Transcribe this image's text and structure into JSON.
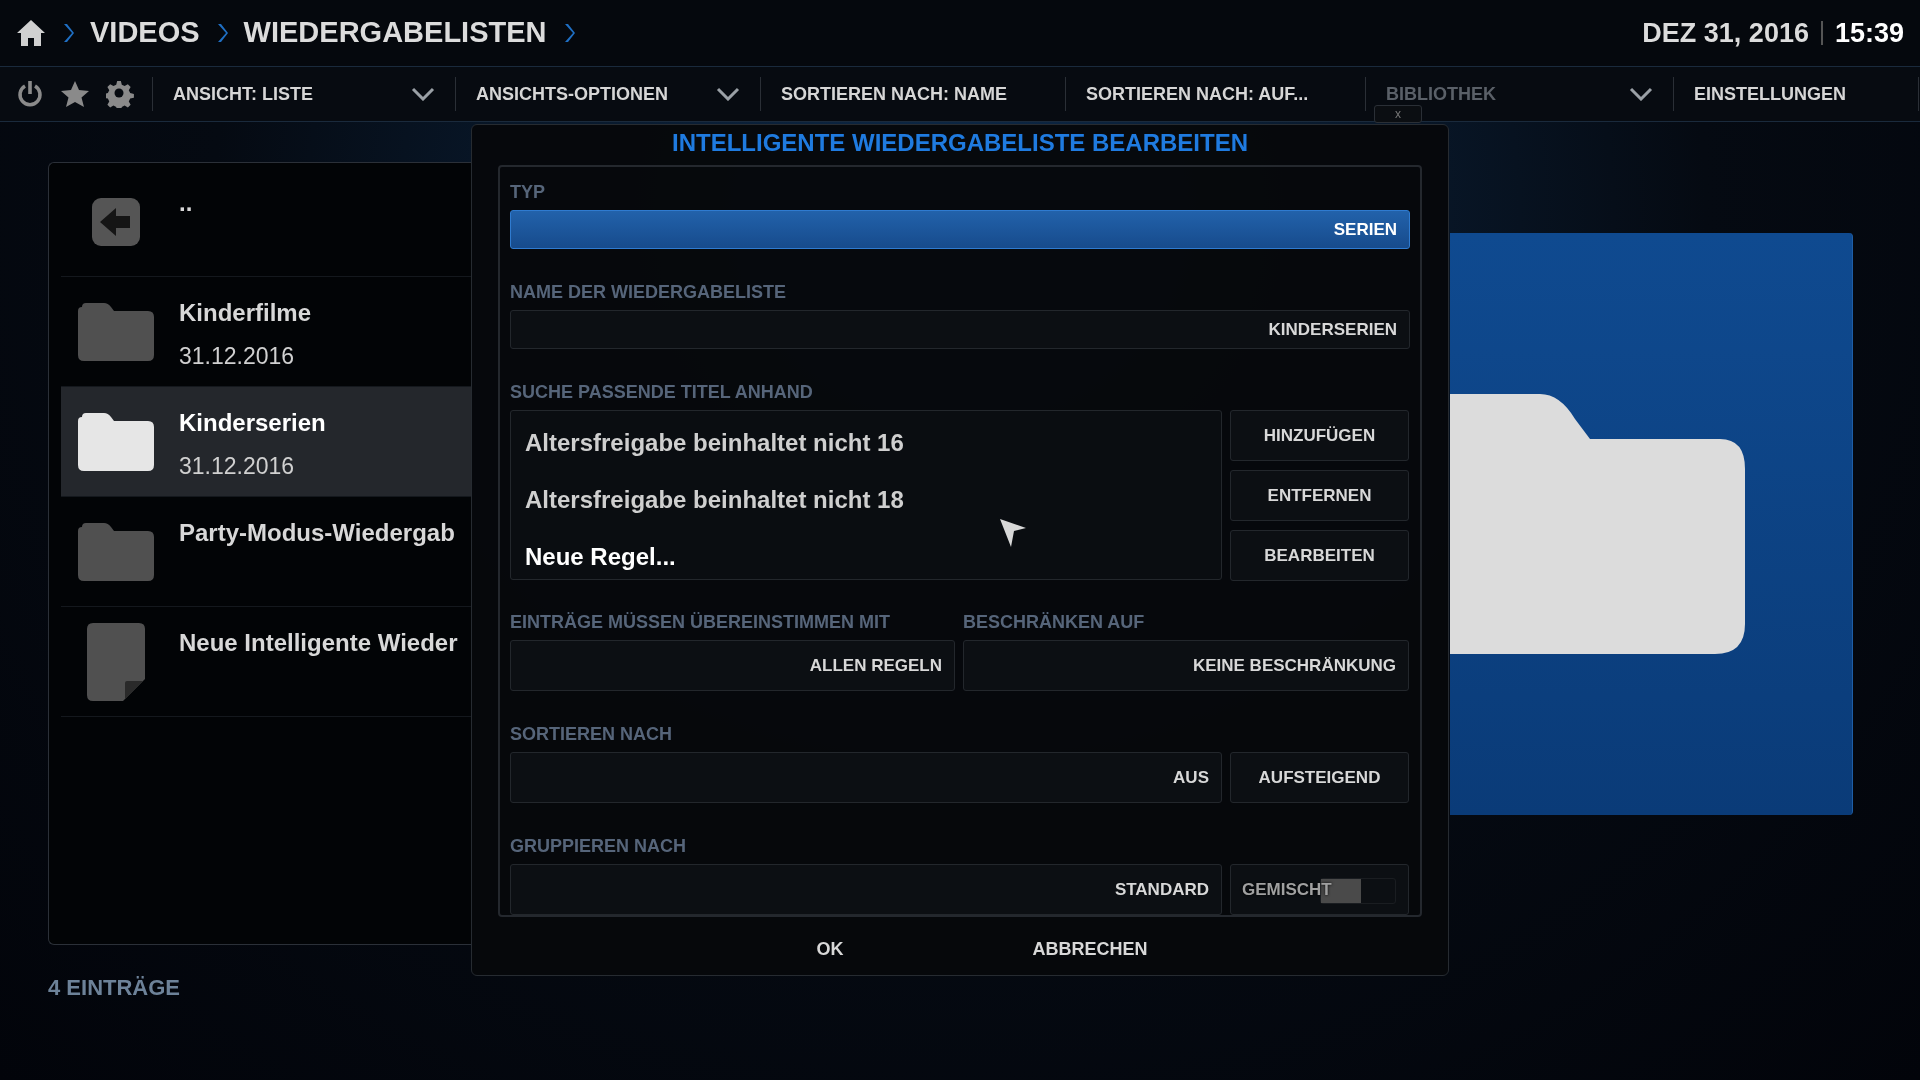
{
  "header": {
    "breadcrumbs": [
      "VIDEOS",
      "WIEDERGABELISTEN"
    ],
    "date": "DEZ 31, 2016",
    "time": "15:39"
  },
  "toolbar": {
    "items": [
      {
        "label": "ANSICHT: LISTE",
        "dropdown": true,
        "disabled": false
      },
      {
        "label": "ANSICHTS-OPTIONEN",
        "dropdown": true,
        "disabled": false
      },
      {
        "label": "SORTIEREN NACH: NAME",
        "dropdown": false,
        "disabled": false
      },
      {
        "label": "SORTIEREN NACH: AUF...",
        "dropdown": false,
        "disabled": false
      },
      {
        "label": "BIBLIOTHEK",
        "dropdown": true,
        "disabled": true
      },
      {
        "label": "EINSTELLUNGEN",
        "dropdown": false,
        "disabled": false
      }
    ]
  },
  "list": {
    "items": [
      {
        "kind": "back",
        "title": "..",
        "selected": false
      },
      {
        "kind": "folder",
        "title": "Kinderfilme",
        "date": "31.12.2016",
        "selected": false
      },
      {
        "kind": "folder",
        "title": "Kinderserien",
        "date": "31.12.2016",
        "selected": true
      },
      {
        "kind": "folder",
        "title": "Party-Modus-Wiedergab",
        "selected": false
      },
      {
        "kind": "file",
        "title": "Neue Intelligente Wieder",
        "selected": false
      }
    ],
    "count": "4 EINTRÄGE"
  },
  "dialog": {
    "title": "INTELLIGENTE WIEDERGABELISTE BEARBEITEN",
    "close_label": "x",
    "type": {
      "label": "TYP",
      "value": "SERIEN",
      "focused": true
    },
    "name": {
      "label": "NAME DER WIEDERGABELISTE",
      "value": "KINDERSERIEN",
      "focused": false
    },
    "rules": {
      "label": "SUCHE PASSENDE TITEL ANHAND",
      "items": [
        {
          "text": "Altersfreigabe beinhaltet nicht 16",
          "selected": false
        },
        {
          "text": "Altersfreigabe beinhaltet nicht 18",
          "selected": false
        },
        {
          "text": "Neue Regel...",
          "selected": true
        }
      ],
      "buttons": [
        "HINZUFÜGEN",
        "ENTFERNEN",
        "BEARBEITEN"
      ]
    },
    "match": {
      "label": "EINTRÄGE MÜSSEN ÜBEREINSTIMMEN MIT",
      "value": "ALLEN REGELN"
    },
    "limit": {
      "label": "BESCHRÄNKEN AUF",
      "value": "KEINE BESCHRÄNKUNG"
    },
    "sort": {
      "label": "SORTIEREN NACH",
      "value": "AUS",
      "order": "AUFSTEIGEND"
    },
    "group": {
      "label": "GRUPPIEREN NACH",
      "value": "STANDARD",
      "mixed": {
        "label": "GEMISCHT",
        "on": false
      }
    },
    "buttons": [
      "OK",
      "ABBRECHEN"
    ]
  }
}
